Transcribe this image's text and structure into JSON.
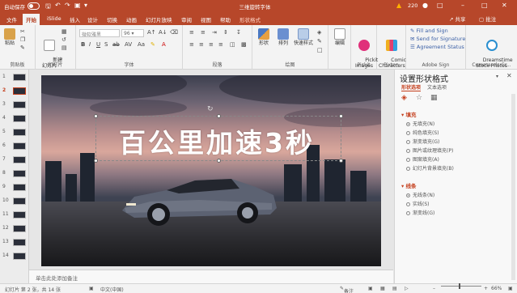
{
  "titlebar": {
    "autosave_label": "自动保存",
    "toggle_state": "关",
    "document_title": "三维旋转字体",
    "user_badge": "220"
  },
  "tabs": {
    "file": "文件",
    "home": "开始",
    "islide": "iSlide",
    "insert": "插入",
    "design": "设计",
    "transitions": "切换",
    "animations": "动画",
    "slideshow": "幻灯片放映",
    "review": "审阅",
    "view": "视图",
    "help": "帮助",
    "shape_format": "形状格式",
    "share": "共享",
    "comments": "批注"
  },
  "ribbon": {
    "paste": "粘贴",
    "clipboard": "剪贴板",
    "new_slide": "新建\n幻灯片",
    "slides": "幻灯片",
    "font_placeholder": "微软雅黑",
    "font": "字体",
    "paragraph": "段落",
    "shape": "形状",
    "arrange": "排列",
    "quick_styles": "快速样式",
    "drawing": "绘图",
    "edit": "编辑",
    "pickit_images": "Pickit\nImages",
    "pickit": "Pickit",
    "comic": "Comic\nCharacters",
    "pixton": "Pixton",
    "fill_sign": "Fill and Sign",
    "send_signature": "Send for Signature",
    "agreement_status": "Agreement Status",
    "adobe_sign": "Adobe Sign",
    "dreamstime": "Dreamstime\nStock Photos",
    "commands_group": "Commands Gr..."
  },
  "thumbnails": [
    "1",
    "2",
    "3",
    "4",
    "5",
    "6",
    "7",
    "8",
    "9",
    "10",
    "11",
    "12",
    "13",
    "14"
  ],
  "slide": {
    "headline": "百公里加速3秒",
    "notes_placeholder": "单击此处添加备注"
  },
  "pane": {
    "title": "设置形状格式",
    "tab_shape": "形状选项",
    "tab_text": "文本选项",
    "fill_section": "填充",
    "fill_options": [
      "无填充(N)",
      "纯色填充(S)",
      "渐变填充(G)",
      "图片或纹理填充(P)",
      "图案填充(A)",
      "幻灯片背景填充(B)"
    ],
    "line_section": "线条",
    "line_options": [
      "无线条(N)",
      "实线(S)",
      "渐变线(G)"
    ]
  },
  "statusbar": {
    "slide_info": "幻灯片 第 2 张，共 14 张",
    "language": "中文(中国)",
    "notes": "备注",
    "zoom": "66%"
  },
  "colors": {
    "accent": "#b7472a",
    "pane_accent": "#c43e1c"
  }
}
